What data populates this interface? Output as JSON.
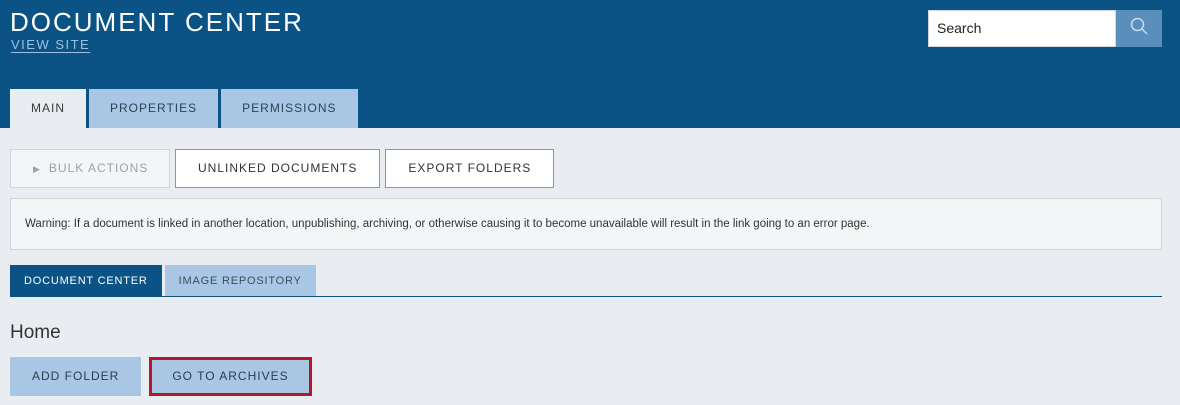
{
  "header": {
    "title": "DOCUMENT CENTER",
    "view_site": "VIEW SITE",
    "search_value": "Search",
    "search_icon": "magnifier-icon"
  },
  "main_tabs": [
    {
      "label": "MAIN",
      "active": true
    },
    {
      "label": "PROPERTIES",
      "active": false
    },
    {
      "label": "PERMISSIONS",
      "active": false
    }
  ],
  "actions": {
    "bulk": "BULK ACTIONS",
    "bulk_icon": "triangle-right-icon",
    "unlinked": "UNLINKED DOCUMENTS",
    "export": "EXPORT FOLDERS"
  },
  "warning": "Warning: If a document is linked in another location, unpublishing, archiving, or otherwise causing it to become unavailable will result in the link going to an error page.",
  "sub_tabs": [
    {
      "label": "DOCUMENT CENTER",
      "active": true
    },
    {
      "label": "IMAGE REPOSITORY",
      "active": false
    }
  ],
  "home_title": "Home",
  "bottom": {
    "add_folder": "ADD FOLDER",
    "archives": "GO TO ARCHIVES"
  },
  "colors": {
    "header": "#0b5385",
    "tab_inactive": "#a9c7e4",
    "highlight": "#b3172b"
  }
}
